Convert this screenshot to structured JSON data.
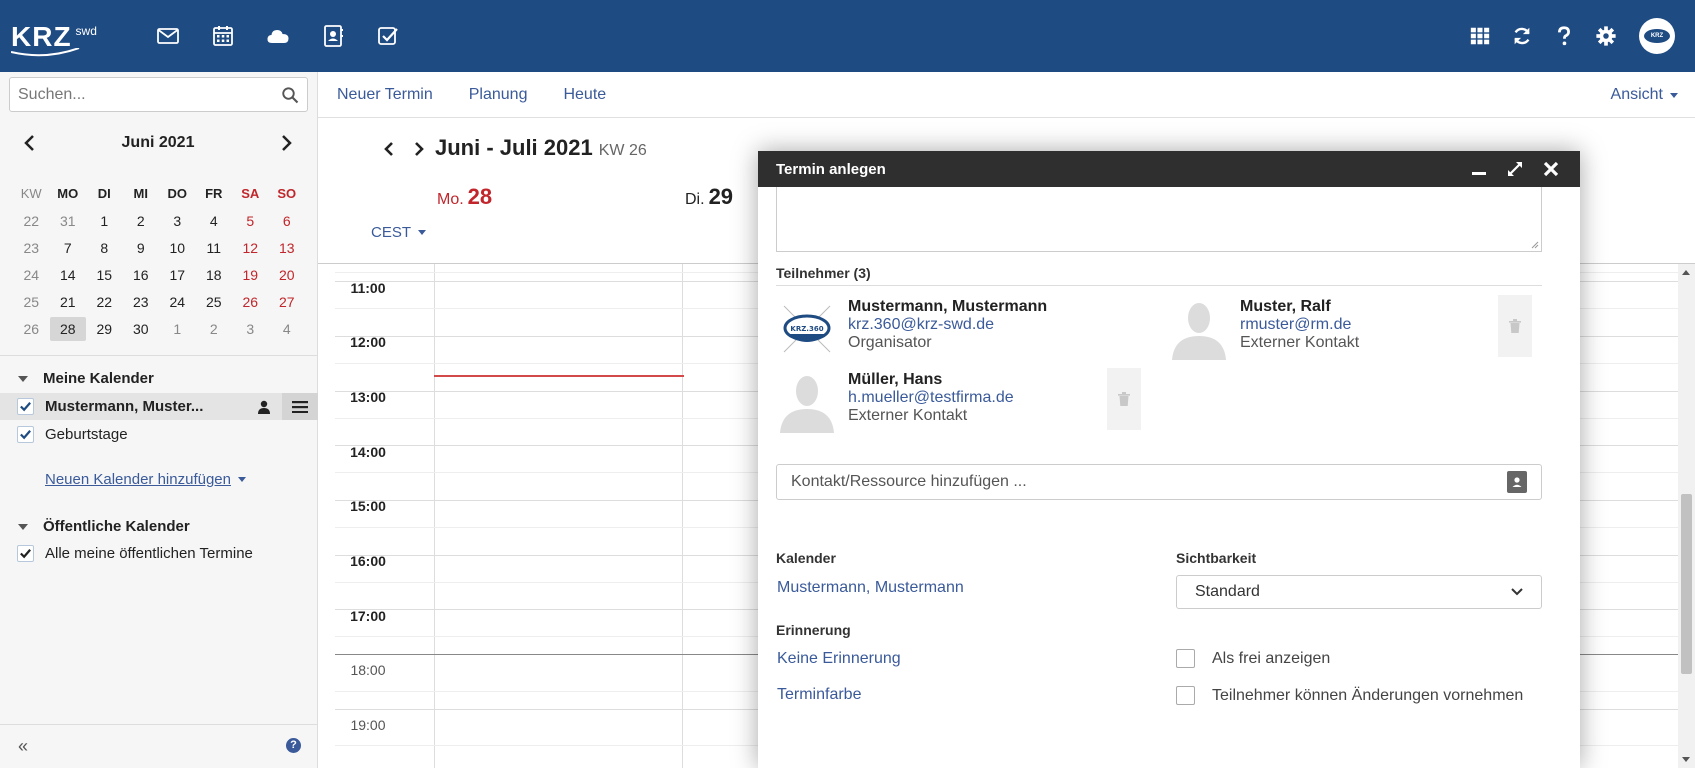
{
  "brand": {
    "logo_main": "KRZ",
    "logo_sub": "swd",
    "avatar_text": "KRZ"
  },
  "sidebar": {
    "search_placeholder": "Suchen...",
    "mini_calendar": {
      "title": "Juni 2021",
      "headers": [
        "KW",
        "MO",
        "DI",
        "MI",
        "DO",
        "FR",
        "SA",
        "SO"
      ],
      "weeks": [
        [
          "22",
          "31",
          "1",
          "2",
          "3",
          "4",
          "5",
          "6"
        ],
        [
          "23",
          "7",
          "8",
          "9",
          "10",
          "11",
          "12",
          "13"
        ],
        [
          "24",
          "14",
          "15",
          "16",
          "17",
          "18",
          "19",
          "20"
        ],
        [
          "25",
          "21",
          "22",
          "23",
          "24",
          "25",
          "26",
          "27"
        ],
        [
          "26",
          "28",
          "29",
          "30",
          "1",
          "2",
          "3",
          "4"
        ]
      ]
    },
    "my_calendars_title": "Meine Kalender",
    "my_calendars": [
      "Mustermann, Muster...",
      "Geburtstage"
    ],
    "add_calendar": "Neuen Kalender hinzufügen",
    "public_calendars_title": "Öffentliche Kalender",
    "public_calendars": [
      "Alle meine öffentlichen Termine"
    ],
    "collapse_label": "«",
    "help_label": "?"
  },
  "toolbar": {
    "new_event": "Neuer Termin",
    "planning": "Planung",
    "today": "Heute",
    "view": "Ansicht"
  },
  "calendar": {
    "period": "Juni - Juli 2021",
    "week": "KW 26",
    "days": [
      {
        "weekday": "Mo.",
        "day": "28"
      },
      {
        "weekday": "Di.",
        "day": "29"
      }
    ],
    "timezone": "CEST",
    "hours": [
      "11:00",
      "12:00",
      "13:00",
      "14:00",
      "15:00",
      "16:00",
      "17:00",
      "18:00",
      "19:00"
    ]
  },
  "dialog": {
    "title": "Termin anlegen",
    "participants_title": "Teilnehmer (3)",
    "participants": [
      {
        "name": "Mustermann, Mustermann",
        "email": "krz.360@krz-swd.de",
        "role": "Organisator",
        "avatar_text": "KRZ.360"
      },
      {
        "name": "Muster, Ralf",
        "email": "rmuster@rm.de",
        "role": "Externer Kontakt"
      },
      {
        "name": "Müller, Hans",
        "email": "h.mueller@testfirma.de",
        "role": "Externer Kontakt"
      }
    ],
    "contact_placeholder": "Kontakt/Ressource hinzufügen ...",
    "calendar_label": "Kalender",
    "calendar_value": "Mustermann, Mustermann",
    "visibility_label": "Sichtbarkeit",
    "visibility_value": "Standard",
    "reminder_label": "Erinnerung",
    "reminder_value": "Keine Erinnerung",
    "color_label": "Terminfarbe",
    "show_free": "Als frei anzeigen",
    "participants_can_edit": "Teilnehmer können Änderungen vornehmen"
  },
  "colors": {
    "header": "#1f4b83",
    "link": "#3a5a9a",
    "weekend": "#c0262b",
    "dialog_title": "#2f2f2f"
  }
}
